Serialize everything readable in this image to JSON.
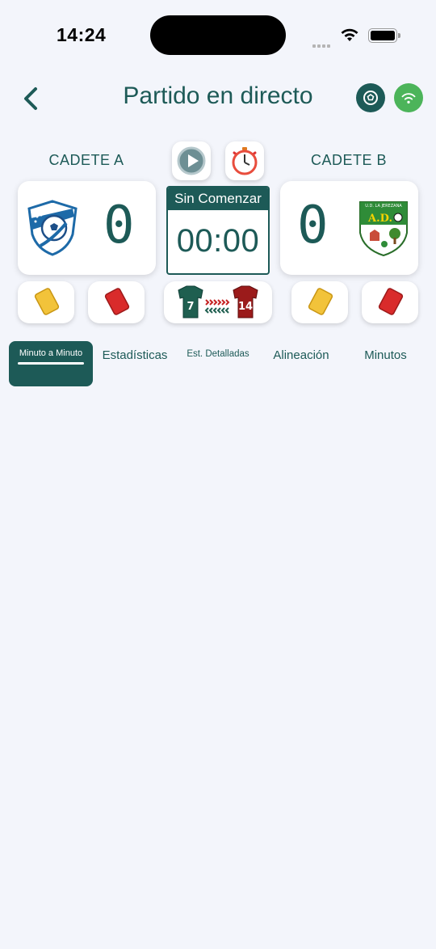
{
  "status_bar": {
    "time": "14:24"
  },
  "header": {
    "title": "Partido en directo"
  },
  "teams": {
    "home": {
      "name": "CADETE A",
      "score": "0"
    },
    "away": {
      "name": "CADETE B",
      "score": "0",
      "crest_text": "U.D. LA JEREZANA",
      "crest_initials": "A.D."
    }
  },
  "clock": {
    "status": "Sin Comenzar",
    "time": "00:00"
  },
  "substitution": {
    "out_number": "7",
    "in_number": "14"
  },
  "tabs": [
    {
      "label": "Minuto a Minuto",
      "active": true
    },
    {
      "label": "Estadísticas"
    },
    {
      "label": "Est. Detalladas"
    },
    {
      "label": "Alineación"
    },
    {
      "label": "Minutos"
    }
  ],
  "colors": {
    "primary": "#1d5a57",
    "live": "#4cb45a",
    "yellow_card": "#f2c33a",
    "red_card": "#d92b2b",
    "background": "#f3f5fb"
  }
}
